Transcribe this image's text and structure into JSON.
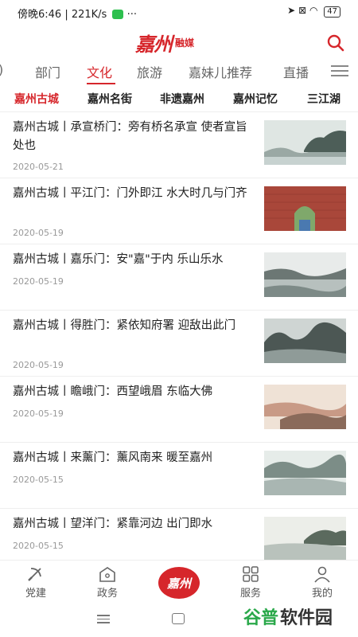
{
  "status_bar": {
    "time_speed": "傍晚6:46 | 221K/s",
    "battery": "47",
    "menu_dots": "···"
  },
  "header": {
    "logo_main": "嘉州",
    "logo_sub": "融媒"
  },
  "category_tabs": [
    {
      "label": "部门"
    },
    {
      "label": "文化",
      "active": true
    },
    {
      "label": "旅游"
    },
    {
      "label": "嘉妹儿推荐"
    },
    {
      "label": "直播"
    }
  ],
  "sub_tabs": [
    {
      "label": "嘉州古城",
      "active": true
    },
    {
      "label": "嘉州名街"
    },
    {
      "label": "非遗嘉州"
    },
    {
      "label": "嘉州记忆"
    },
    {
      "label": "三江湖"
    }
  ],
  "articles": [
    {
      "title": "嘉州古城丨承宣桥门：旁有桥名承宣 使者宣旨处也",
      "date": "2020-05-21",
      "thumb": "landscape-painting"
    },
    {
      "title": "嘉州古城丨平江门：门外即江 水大时几与门齐",
      "date": "2020-05-19",
      "thumb": "city-gate-photo"
    },
    {
      "title": "嘉州古城丨嘉乐门：安\"嘉\"于内 乐山乐水",
      "date": "2020-05-19",
      "thumb": "river-painting"
    },
    {
      "title": "嘉州古城丨得胜门：紧依知府署 迎敌出此门",
      "date": "2020-05-19",
      "thumb": "mountain-painting"
    },
    {
      "title": "嘉州古城丨瞻峨门：西望峨眉 东临大佛",
      "date": "2020-05-19",
      "thumb": "warm-landscape"
    },
    {
      "title": "嘉州古城丨来薰门：薰风南来 暖至嘉州",
      "date": "2020-05-15",
      "thumb": "misty-painting"
    },
    {
      "title": "嘉州古城丨望洋门：紧靠河边 出门即水",
      "date": "2020-05-15",
      "thumb": "riverbank-painting"
    }
  ],
  "bottom_nav": [
    {
      "label": "党建",
      "icon": "party-emblem-icon"
    },
    {
      "label": "政务",
      "icon": "government-icon"
    },
    {
      "label": "嘉州",
      "icon": "home-logo"
    },
    {
      "label": "服务",
      "icon": "grid-icon"
    },
    {
      "label": "我的",
      "icon": "user-icon"
    }
  ],
  "watermark": {
    "part1": "谷普",
    "part2": "软件园"
  },
  "colors": {
    "accent": "#d6262b",
    "text": "#222222",
    "muted": "#999999"
  }
}
